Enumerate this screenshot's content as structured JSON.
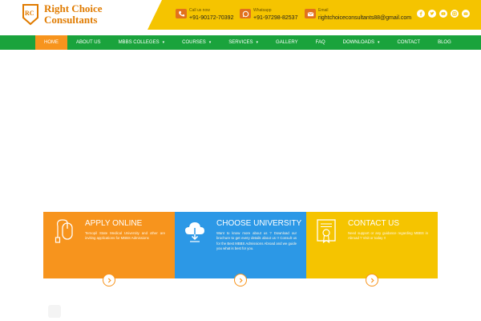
{
  "brand": {
    "line1": "Right Choice",
    "line2": "Consultants",
    "badge_letters": "RC"
  },
  "contacts": [
    {
      "icon": "phone-icon",
      "label": "Call us now",
      "value": "+91-90172-70392"
    },
    {
      "icon": "whatsapp-icon",
      "label": "Whatsapp",
      "value": "+91-97298-82537"
    },
    {
      "icon": "mail-icon",
      "label": "Email",
      "value": "rightchoiceconsultants88@gmail.com"
    }
  ],
  "socials": [
    "facebook-icon",
    "twitter-icon",
    "youtube-icon",
    "instagram-icon",
    "mail-icon"
  ],
  "nav": {
    "items": [
      {
        "label": "HOME",
        "active": true,
        "dropdown": false
      },
      {
        "label": "ABOUT US",
        "active": false,
        "dropdown": false
      },
      {
        "label": "MBBS COLLEGES",
        "active": false,
        "dropdown": true
      },
      {
        "label": "COURSES",
        "active": false,
        "dropdown": true
      },
      {
        "label": "SERVICES",
        "active": false,
        "dropdown": true
      },
      {
        "label": "GALLERY",
        "active": false,
        "dropdown": false
      },
      {
        "label": "FAQ",
        "active": false,
        "dropdown": false
      },
      {
        "label": "DOWNLOADS",
        "active": false,
        "dropdown": true
      },
      {
        "label": "CONTACT",
        "active": false,
        "dropdown": false
      },
      {
        "label": "BLOG",
        "active": false,
        "dropdown": false
      }
    ],
    "caret": "▾"
  },
  "cards": [
    {
      "title": "APPLY ONLINE",
      "desc": "Ternopil State Medical University and other are inviting applications for MBBS Admissions",
      "color": "#f7941d"
    },
    {
      "title": "CHOOSE UNIVERSITY",
      "desc": "Want to know more about us ? Download our brochure to get every details about us !! Consult us for the Best MBBS Admissions Abroad and we guide you what is best for you.",
      "color": "#2c98e6"
    },
    {
      "title": "CONTACT US",
      "desc": "Need support or any guidance regarding MBBS in Abroad ? Visit or today !!",
      "color": "#f5c400"
    }
  ],
  "colors": {
    "accent_orange": "#f7941d",
    "nav_green": "#1aa33c",
    "header_yellow": "#f5c400",
    "blue": "#2c98e6"
  }
}
